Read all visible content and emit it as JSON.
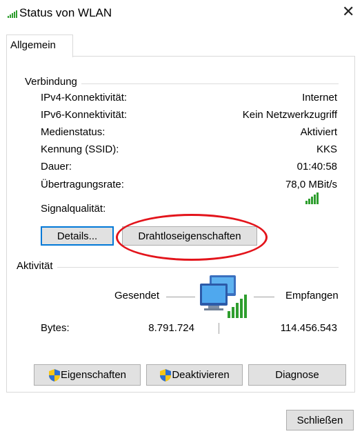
{
  "window": {
    "title": "Status von WLAN",
    "close_glyph": "✕"
  },
  "tabs": [
    {
      "label": "Allgemein"
    }
  ],
  "connection": {
    "heading": "Verbindung",
    "rows": [
      {
        "label": "IPv4-Konnektivität:",
        "value": "Internet"
      },
      {
        "label": "IPv6-Konnektivität:",
        "value": "Kein Netzwerkzugriff"
      },
      {
        "label": "Medienstatus:",
        "value": "Aktiviert"
      },
      {
        "label": "Kennung (SSID):",
        "value": "KKS"
      },
      {
        "label": "Dauer:",
        "value": "01:40:58"
      },
      {
        "label": "Übertragungsrate:",
        "value": "78,0 MBit/s"
      }
    ],
    "signal_label": "Signalqualität:",
    "signal_bars": 5,
    "details_button": "Details...",
    "wireless_props_button": "Drahtloseigenschaften"
  },
  "activity": {
    "heading": "Aktivität",
    "sent_label": "Gesendet",
    "received_label": "Empfangen",
    "bytes_label": "Bytes:",
    "bytes_sent": "8.791.724",
    "bytes_received": "114.456.543"
  },
  "actions": {
    "properties_button": "Eigenschaften",
    "disable_button": "Deaktivieren",
    "diagnose_button": "Diagnose"
  },
  "footer": {
    "close_button": "Schließen"
  },
  "colors": {
    "accent": "#0078d7",
    "highlight": "#e3141b",
    "signal": "#2e9e2e"
  }
}
